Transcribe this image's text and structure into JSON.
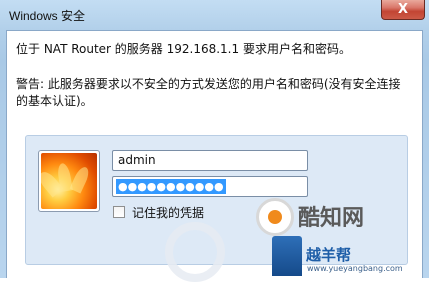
{
  "window": {
    "title": "Windows 安全",
    "close_icon": "close-icon",
    "close_glyph": "X"
  },
  "messages": {
    "line1": "位于 NAT Router 的服务器 192.168.1.1 要求用户名和密码。",
    "line2": "警告: 此服务器要求以不安全的方式发送您的用户名和密码(没有安全连接",
    "line3": "的基本认证)。"
  },
  "credentials": {
    "avatar_icon": "flower-avatar-icon",
    "username_value": "admin",
    "password_value": "●●●●●●●●●●●",
    "remember_label": "记住我的凭据",
    "remember_checked": false
  },
  "watermark": {
    "brand": "酷知网",
    "site": "越羊帮",
    "url": "www.yueyangbang.com"
  },
  "colors": {
    "frame": "#b2d0ea",
    "panel": "#dde9f6",
    "selection": "#3399ff",
    "close": "#c24533"
  }
}
